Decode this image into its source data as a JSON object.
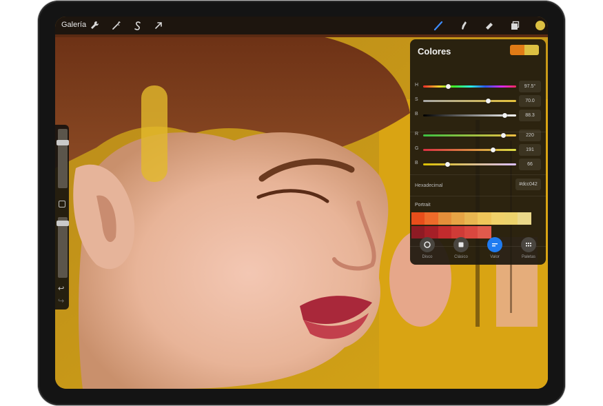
{
  "toolbar": {
    "gallery_label": "Galería",
    "left_tools": [
      "wrench-icon",
      "magic-wand-icon",
      "selection-s-icon",
      "transform-arrow-icon"
    ],
    "right_tools": [
      "brush-icon",
      "smudge-icon",
      "eraser-icon",
      "layers-icon",
      "color-dot-icon"
    ],
    "active_color": "#dcc042"
  },
  "colors_panel": {
    "title": "Colores",
    "current_swatch": "#e07b16",
    "previous_swatch": "#dcc042",
    "hsb": [
      {
        "label": "H",
        "value": "97.5°",
        "fraction": 0.27
      },
      {
        "label": "S",
        "value": "70.0",
        "fraction": 0.7
      },
      {
        "label": "B",
        "value": "88.3",
        "fraction": 0.88
      }
    ],
    "rgb": [
      {
        "label": "R",
        "value": "220",
        "fraction": 0.86
      },
      {
        "label": "G",
        "value": "191",
        "fraction": 0.75
      },
      {
        "label": "B",
        "value": "66",
        "fraction": 0.26
      }
    ],
    "hex_label": "Hexadecimal",
    "hex_value": "#dcc042",
    "palette_name": "Portrait",
    "palette_row1": [
      "#e84e1b",
      "#ee6b2a",
      "#e58f3a",
      "#e6a445",
      "#e8b651",
      "#efc65a",
      "#f0d16a",
      "#ecd26c",
      "#ead88a"
    ],
    "palette_row2": [
      "#8e1b24",
      "#a61f27",
      "#c22b2d",
      "#cf3b37",
      "#d9473f",
      "#e05a4c"
    ],
    "tabs": [
      {
        "label": "Disco",
        "active": false
      },
      {
        "label": "Clásico",
        "active": false
      },
      {
        "label": "Valor",
        "active": true
      },
      {
        "label": "Paletas",
        "active": false
      }
    ]
  },
  "sidebar": {
    "brush_size_fraction": 0.1,
    "opacity_fraction": 0.05,
    "undo_glyph": "↩",
    "redo_glyph": "↪"
  }
}
